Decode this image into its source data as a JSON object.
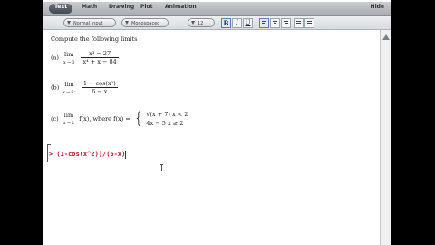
{
  "tabs": [
    {
      "label": "Text"
    },
    {
      "label": "Math"
    },
    {
      "label": "Drawing"
    },
    {
      "label": "Plot"
    },
    {
      "label": "Animation"
    }
  ],
  "hide_label": "Hide",
  "toolbar": {
    "style_value": "Normal Input",
    "font_value": "Monospaced",
    "size_value": "12",
    "bold_label": "B",
    "italic_label": "I",
    "underline_label": "U"
  },
  "document": {
    "prompt": "Compute the following limits",
    "a": {
      "label": "(a)",
      "lim": "lim",
      "sub": "x → 3",
      "num": "x³ − 27",
      "den": "x⁴ + x − 84"
    },
    "b": {
      "label": "(b)",
      "lim": "lim",
      "sub": "x → 6⁻",
      "num": "1 − cos(x²)",
      "den": "6 − x"
    },
    "c": {
      "label": "(c)",
      "lim": "lim",
      "sub": "x → 2",
      "expr": "f(x), where f(x) =",
      "case1": "√(x + 7)   x < 2",
      "case2": "4x − 5   x ≥ 2"
    },
    "input": "> (1-cos(x^2))/(6-x)"
  }
}
